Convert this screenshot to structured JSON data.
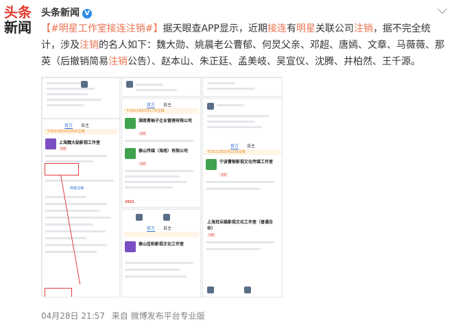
{
  "account": {
    "logo_line1": "头条",
    "logo_line2": "新闻",
    "name": "头条新闻",
    "verified": "V"
  },
  "post": {
    "segments": [
      {
        "t": "【#",
        "c": "tag"
      },
      {
        "t": "明星工作室接连注销",
        "c": "tag"
      },
      {
        "t": "#】",
        "c": "tag"
      },
      {
        "t": "据天眼查APP显示，近期",
        "c": ""
      },
      {
        "t": "接连",
        "c": "hl"
      },
      {
        "t": "有",
        "c": ""
      },
      {
        "t": "明星",
        "c": "hl"
      },
      {
        "t": "关联公司",
        "c": ""
      },
      {
        "t": "注销",
        "c": "hl"
      },
      {
        "t": "，据不完全统计，涉及",
        "c": ""
      },
      {
        "t": "注销",
        "c": "hl"
      },
      {
        "t": "的名人如下：魏大勋、姚晨老公曹郁、何炅父亲、邓超、唐嫣、文章、马薇薇、那英（后撤销简易",
        "c": ""
      },
      {
        "t": "注销",
        "c": "hl"
      },
      {
        "t": "公告）、赵本山、朱正廷、孟美岐、吴宣仪、沈腾、井柏然、王千源。",
        "c": ""
      }
    ]
  },
  "image": {
    "tab_official": "官方",
    "tab_self": "自主",
    "notice_2021": "于2021年04月29日注销",
    "notice_2021b": "于2021年03月17日注销",
    "notice_2021c": "于2021年03月22日注销",
    "co1": "上海魏大勋影视工作室",
    "co2": "湖南青柚子企业管理有限公司",
    "co3": "泰山传媒（海南）有限公司",
    "co4": "宁波曹郁影视文化传媒工作室",
    "co5": "上海耳朵猫影视文化工作室（普通合伙）",
    "co6": "泰山佳柏影视文化工作室",
    "status_cancel": "注销",
    "status_simple": "简易注销",
    "notice_title": "注销备案公告详情",
    "badge_year": "2021"
  },
  "footer": {
    "date": "04月28日 21:57",
    "source": "来自 微博发布平台专业版"
  },
  "colors": {
    "highlight": "#eb7350",
    "accent_blue": "#2b6fd6",
    "alert_red": "#e23a3a",
    "notice_orange": "#e8891d"
  }
}
